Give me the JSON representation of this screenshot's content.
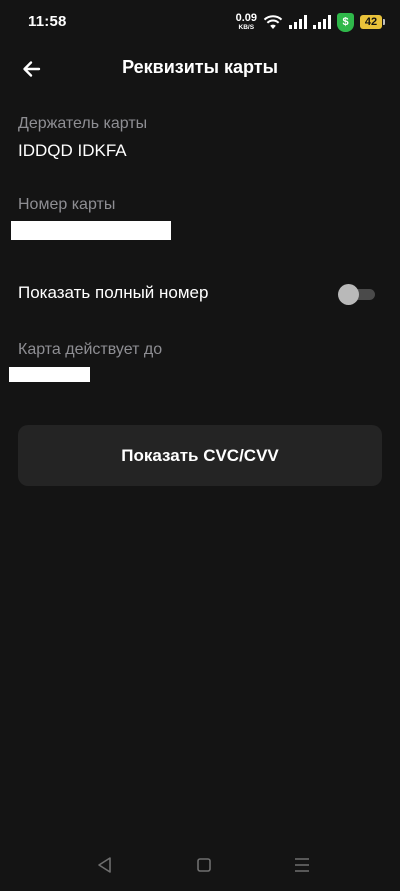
{
  "status_bar": {
    "time": "11:58",
    "net_speed_value": "0.09",
    "net_speed_unit": "KB/S",
    "shield_glyph": "$",
    "battery_level": "42",
    "colors": {
      "shield": "#2fb84a",
      "battery": "#e9c23a"
    }
  },
  "header": {
    "title": "Реквизиты карты",
    "back_icon": "arrow-left-icon"
  },
  "fields": {
    "holder_label": "Держатель карты",
    "holder_value": "IDDQD IDKFA",
    "number_label": "Номер карты",
    "expiry_label": "Карта действует до"
  },
  "toggle": {
    "label": "Показать полный номер",
    "enabled": false
  },
  "cvc_button": {
    "label": "Показать CVC/CVV"
  },
  "nav_bar": {
    "items": [
      "back-triangle-icon",
      "home-square-icon",
      "menu-lines-icon"
    ]
  },
  "theme": {
    "background": "#141414",
    "label_color": "#8e8e93",
    "button_bg": "#242424"
  }
}
